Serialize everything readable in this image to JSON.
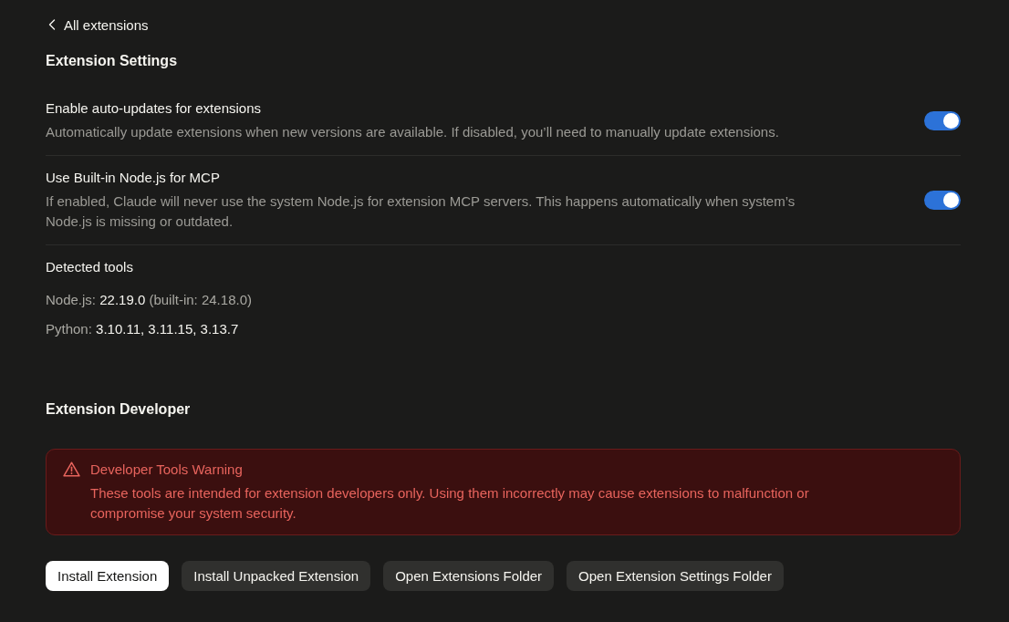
{
  "back_link": {
    "label": "All extensions"
  },
  "extension_settings": {
    "heading": "Extension Settings",
    "settings": [
      {
        "title": "Enable auto-updates for extensions",
        "description": "Automatically update extensions when new versions are available. If disabled, you’ll need to manually update extensions.",
        "on": true
      },
      {
        "title": "Use Built-in Node.js for MCP",
        "description": "If enabled, Claude will never use the system Node.js for extension MCP servers. This happens automatically when system’s Node.js is missing or outdated.",
        "on": true
      }
    ]
  },
  "detected_tools": {
    "heading": "Detected tools",
    "items": [
      "Node.js: **22.19.0** (built-in: 24.18.0)",
      "Python: **3.10.11, 3.11.15, 3.13.7**"
    ]
  },
  "extension_developer": {
    "heading": "Extension Developer",
    "warning": {
      "title": "Developer Tools Warning",
      "message": "These tools are intended for extension developers only. Using them incorrectly may cause extensions to malfunction or compromise your system security."
    },
    "buttons": [
      {
        "label": "Install Extension",
        "kind": "primary"
      },
      {
        "label": "Install Unpacked Extension",
        "kind": "secondary"
      },
      {
        "label": "Open Extensions Folder",
        "kind": "secondary"
      },
      {
        "label": "Open Extension Settings Folder",
        "kind": "secondary"
      }
    ]
  }
}
